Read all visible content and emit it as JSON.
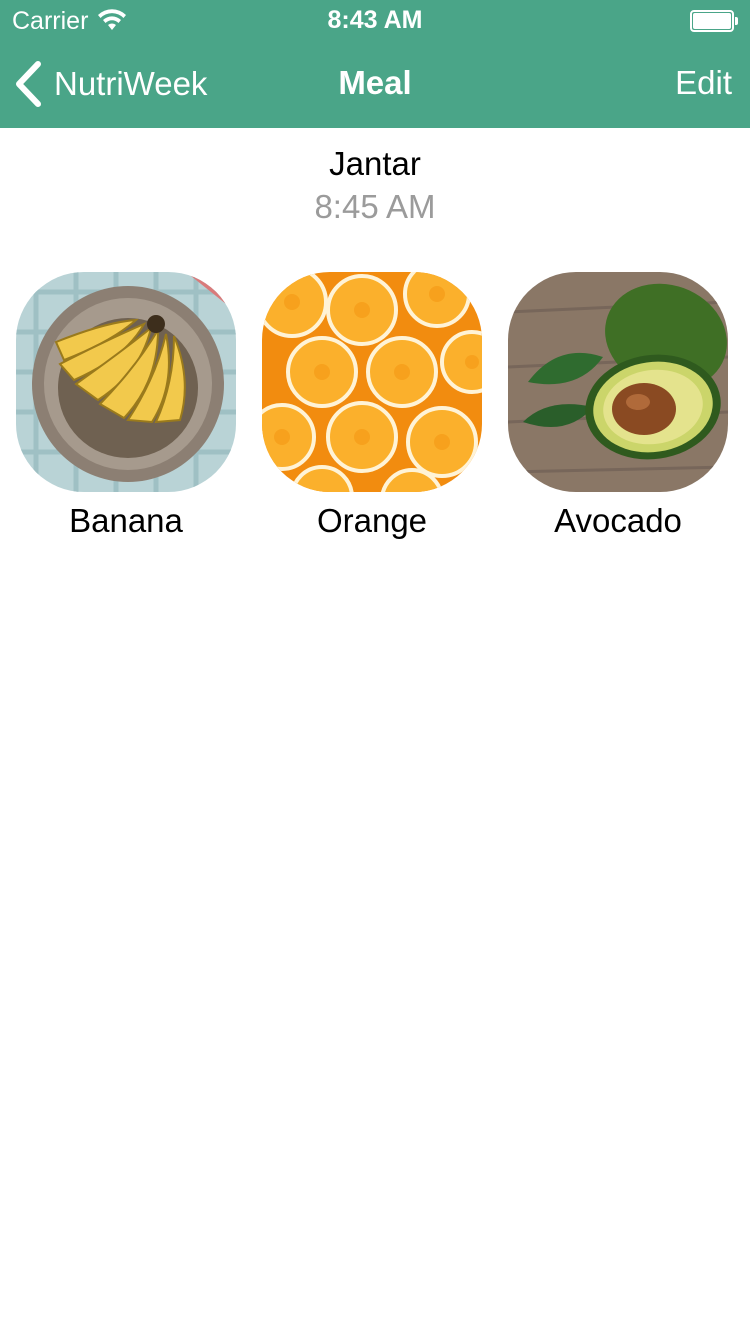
{
  "status_bar": {
    "carrier": "Carrier",
    "time": "8:43 AM"
  },
  "nav": {
    "back_label": "NutriWeek",
    "title": "Meal",
    "edit_label": "Edit"
  },
  "meal": {
    "name": "Jantar",
    "time": "8:45 AM"
  },
  "foods": [
    {
      "label": "Banana",
      "icon": "banana-photo"
    },
    {
      "label": "Orange",
      "icon": "orange-slices-photo"
    },
    {
      "label": "Avocado",
      "icon": "avocado-photo"
    }
  ],
  "colors": {
    "nav_background": "#4aa588",
    "secondary_text": "#9b9b9b"
  }
}
